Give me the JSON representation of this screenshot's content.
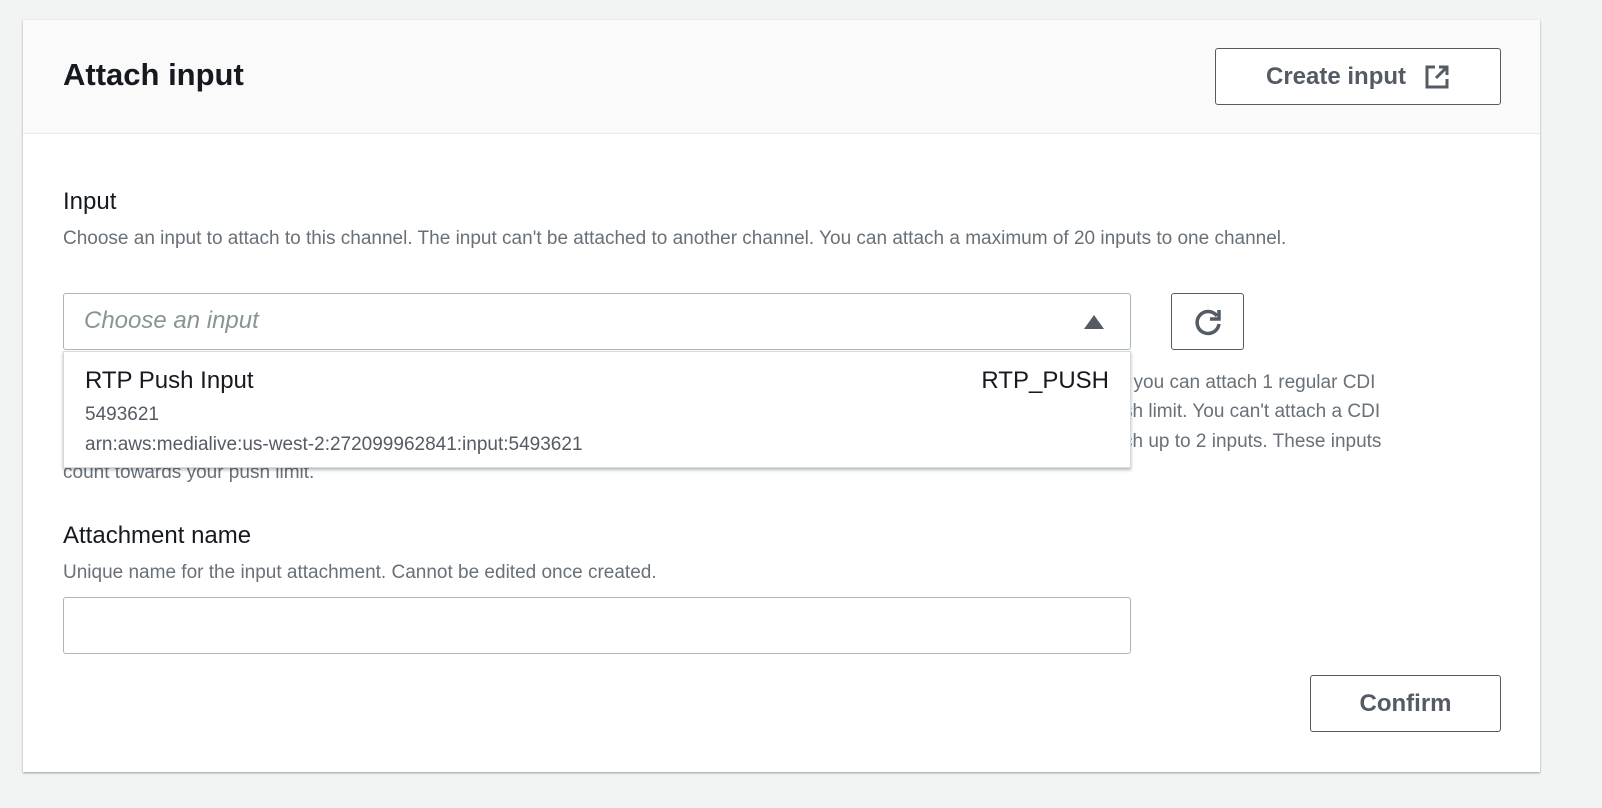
{
  "header": {
    "title": "Attach input",
    "create_button": "Create input"
  },
  "input": {
    "label": "Input",
    "description": "Choose an input to attach to this channel. The input can't be attached to another channel. You can attach a maximum of 20 inputs to one channel.",
    "placeholder": "Choose an input",
    "options": [
      {
        "name": "RTP Push Input",
        "type": "RTP_PUSH",
        "id": "5493621",
        "arn": "arn:aws:medialive:us-west-2:272099962841:input:5493621"
      }
    ],
    "help_fragments": [
      ", you can attach 1 regular CDI",
      "sh limit. You can't attach a CDI",
      "ch up to 2 inputs. These inputs",
      "count towards your push limit."
    ]
  },
  "attachment": {
    "label": "Attachment name",
    "description": "Unique name for the input attachment. Cannot be edited once created.",
    "value": ""
  },
  "confirm_button": "Confirm"
}
